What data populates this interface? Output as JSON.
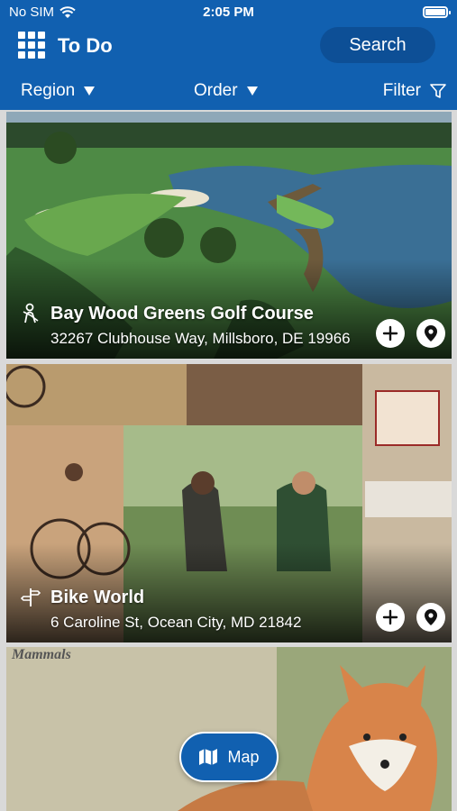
{
  "status_bar": {
    "carrier": "No SIM",
    "time": "2:05 PM"
  },
  "header": {
    "title": "To Do",
    "search_label": "Search"
  },
  "filters": {
    "region": "Region",
    "order": "Order",
    "filter": "Filter"
  },
  "listings": [
    {
      "title": "Bay Wood Greens Golf Course",
      "address": "32267 Clubhouse Way, Millsboro, DE 19966",
      "category_icon": "golfer-icon"
    },
    {
      "title": "Bike World",
      "address": "6 Caroline St, Ocean City, MD 21842",
      "category_icon": "signpost-icon"
    },
    {
      "title": "",
      "address": "",
      "brochure_heading": "Mammals"
    }
  ],
  "map_button": {
    "label": "Map"
  },
  "colors": {
    "brand_blue": "#1160b0",
    "search_pill": "#0d4f96"
  }
}
